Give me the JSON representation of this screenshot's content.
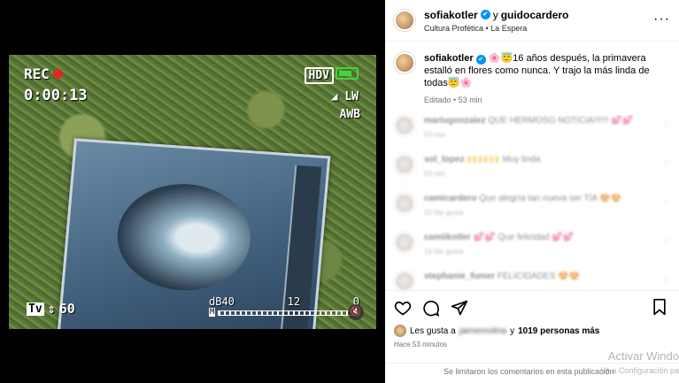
{
  "media": {
    "hud": {
      "rec": "REC",
      "time": "0:00:13",
      "hdv": "HDV",
      "lw": "LW",
      "awb": "AWB",
      "tv": "Tv",
      "tv_value": "60",
      "db_label": "dB40",
      "meter_mid": "12",
      "meter_right": "0",
      "meter_m": "M"
    }
  },
  "header": {
    "username": "sofiakotler",
    "connector": "y",
    "collaborator": "guidocardero",
    "subtitle": "Cultura Profética • La Espera",
    "more": "···"
  },
  "caption": {
    "username": "sofiakotler",
    "text": "🌸😇16 años después, la primavera estalló en flores como nunca. Y trajo la más linda de todas😇🌸",
    "meta": "Editado • 53 min"
  },
  "comments": [
    {
      "user": "mariugonzalez",
      "text": "QUE HERMOSO NOTICIA!!!!!! 💕💕",
      "meta": "53 min"
    },
    {
      "user": "sol_lopez",
      "text": "🙌🙌🙌 Muy linda",
      "meta": "53 min"
    },
    {
      "user": "camicardero",
      "text": "Que alegría tan nueva ser TÍA 😍😍",
      "meta": "10 Me gusta"
    },
    {
      "user": "camiikotler",
      "text": "💕💕 Que felicidad 💕💕",
      "meta": "16 Me gusta"
    },
    {
      "user": "stephanie_fumer",
      "text": "FELICIDADES 😍😍",
      "meta": ""
    }
  ],
  "likes": {
    "prefix": "Les gusta a",
    "liker": "jaimemolina",
    "suffix": "y",
    "count": "1019 personas más",
    "ago": "Hace 53 minutos"
  },
  "footer": {
    "text": "Se limitaron los comentarios en esta publicación"
  },
  "watermark": {
    "line1": "Activar Windo",
    "line2": "Ve a Configuración pa"
  }
}
